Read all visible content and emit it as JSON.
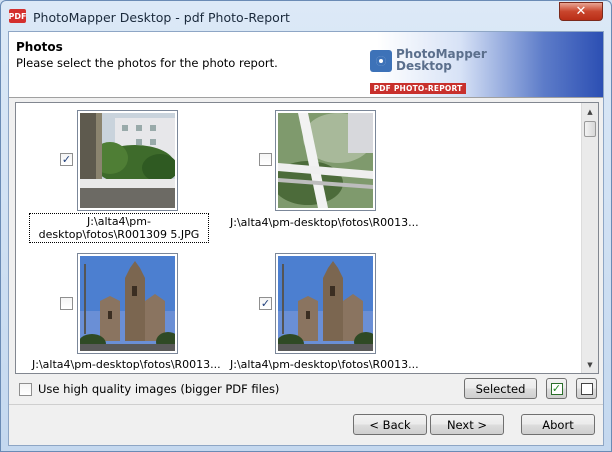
{
  "window": {
    "title": "PhotoMapper Desktop - pdf Photo-Report",
    "app_icon_text": "PDF",
    "close_glyph": "✕"
  },
  "header": {
    "title": "Photos",
    "subtitle": "Please select the photos for the photo report.",
    "logo_name_line1": "PhotoMapper",
    "logo_name_line2": "Desktop",
    "logo_badge": "PDF PHOTO-REPORT"
  },
  "photos": [
    {
      "path": "J:\\alta4\\pm-desktop\\fotos\\R0013095.JPG",
      "display": "J:\\alta4\\pm-desktop\\fotos\\R001309 5.JPG",
      "checked": true,
      "focused": true,
      "scene": "balcony-trees"
    },
    {
      "path": "J:\\alta4\\pm-desktop\\fotos\\R0013...",
      "display": "J:\\alta4\\pm-desktop\\fotos\\R0013...",
      "checked": false,
      "focused": false,
      "scene": "railing"
    },
    {
      "path": "J:\\alta4\\pm-desktop\\fotos\\R0013...",
      "display": "J:\\alta4\\pm-desktop\\fotos\\R0013...",
      "checked": false,
      "focused": false,
      "scene": "church"
    },
    {
      "path": "J:\\alta4\\pm-desktop\\fotos\\R0013...",
      "display": "J:\\alta4\\pm-desktop\\fotos\\R0013...",
      "checked": true,
      "focused": false,
      "scene": "church"
    }
  ],
  "options": {
    "high_quality_label": "Use high quality images (bigger PDF files)",
    "high_quality_checked": false,
    "selected_button": "Selected",
    "select_all_icon": "check-all-icon",
    "select_none_icon": "uncheck-all-icon"
  },
  "navigation": {
    "back": "< Back",
    "next": "Next >",
    "abort": "Abort"
  },
  "colors": {
    "title_close": "#c9452c",
    "logo_badge": "#c8302c",
    "checkmark": "#1f3e7a"
  }
}
